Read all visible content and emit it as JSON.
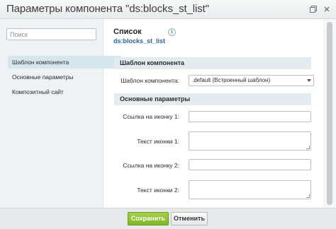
{
  "window": {
    "title": "Параметры компонента \"ds:blocks_st_list\"",
    "icons": [
      "restore-icon",
      "close-icon"
    ]
  },
  "sidebar": {
    "search_placeholder": "Поиск",
    "items": [
      {
        "label": "Шаблон компонента",
        "active": true
      },
      {
        "label": "Основные параметры",
        "active": false
      },
      {
        "label": "Композитный сайт",
        "active": false
      }
    ]
  },
  "component": {
    "title": "Список",
    "code": "ds:blocks_st_list",
    "info_icon": "i"
  },
  "sections": {
    "template": {
      "header": "Шаблон компонента",
      "field_label": "Шаблон компонента:",
      "selected": ".default (Встроенный шаблон)"
    },
    "main": {
      "header": "Основные параметры",
      "fields": [
        {
          "label": "Ссылка на иконку 1:",
          "value": ""
        },
        {
          "label": "Текст иконки 1:",
          "value": ""
        },
        {
          "label": "Ссылка на иконку 2:",
          "value": ""
        },
        {
          "label": "Текст иконки 2:",
          "value": ""
        }
      ]
    }
  },
  "footer": {
    "save_label": "Сохранить",
    "cancel_label": "Отменить"
  },
  "colors": {
    "accent_green": "#8cc22c",
    "link_blue": "#2a6597",
    "sidebar_active": "#d5e6ed"
  }
}
